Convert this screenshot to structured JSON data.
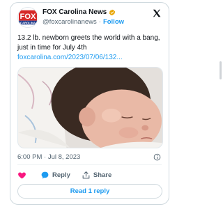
{
  "author": {
    "name": "FOX Carolina News",
    "handle": "@foxcarolinanews",
    "follow_label": "Follow",
    "separator": "·",
    "avatar_logo_text": "FOX",
    "avatar_sub_text": "CAROLINA",
    "verified_color": "#e8a400"
  },
  "tweet": {
    "text": "13.2 lb. newborn greets the world with a bang, just in time for July 4th",
    "link": "foxcarolina.com/2023/07/06/132...",
    "timestamp": "6:00 PM · Jul 8, 2023"
  },
  "actions": {
    "like_label": "",
    "reply_label": "Reply",
    "share_label": "Share",
    "like_color": "#f91880",
    "reply_color": "#1d9bf0"
  },
  "read_replies_label": "Read 1 reply",
  "colors": {
    "accent": "#1d9bf0",
    "text_primary": "#0f1419",
    "text_secondary": "#536471",
    "fox_red": "#d62828",
    "fox_blue": "#1f3a8a"
  },
  "icons": [
    "x-logo-icon",
    "verified-badge-icon",
    "info-icon",
    "heart-icon",
    "reply-bubble-icon",
    "share-icon"
  ]
}
